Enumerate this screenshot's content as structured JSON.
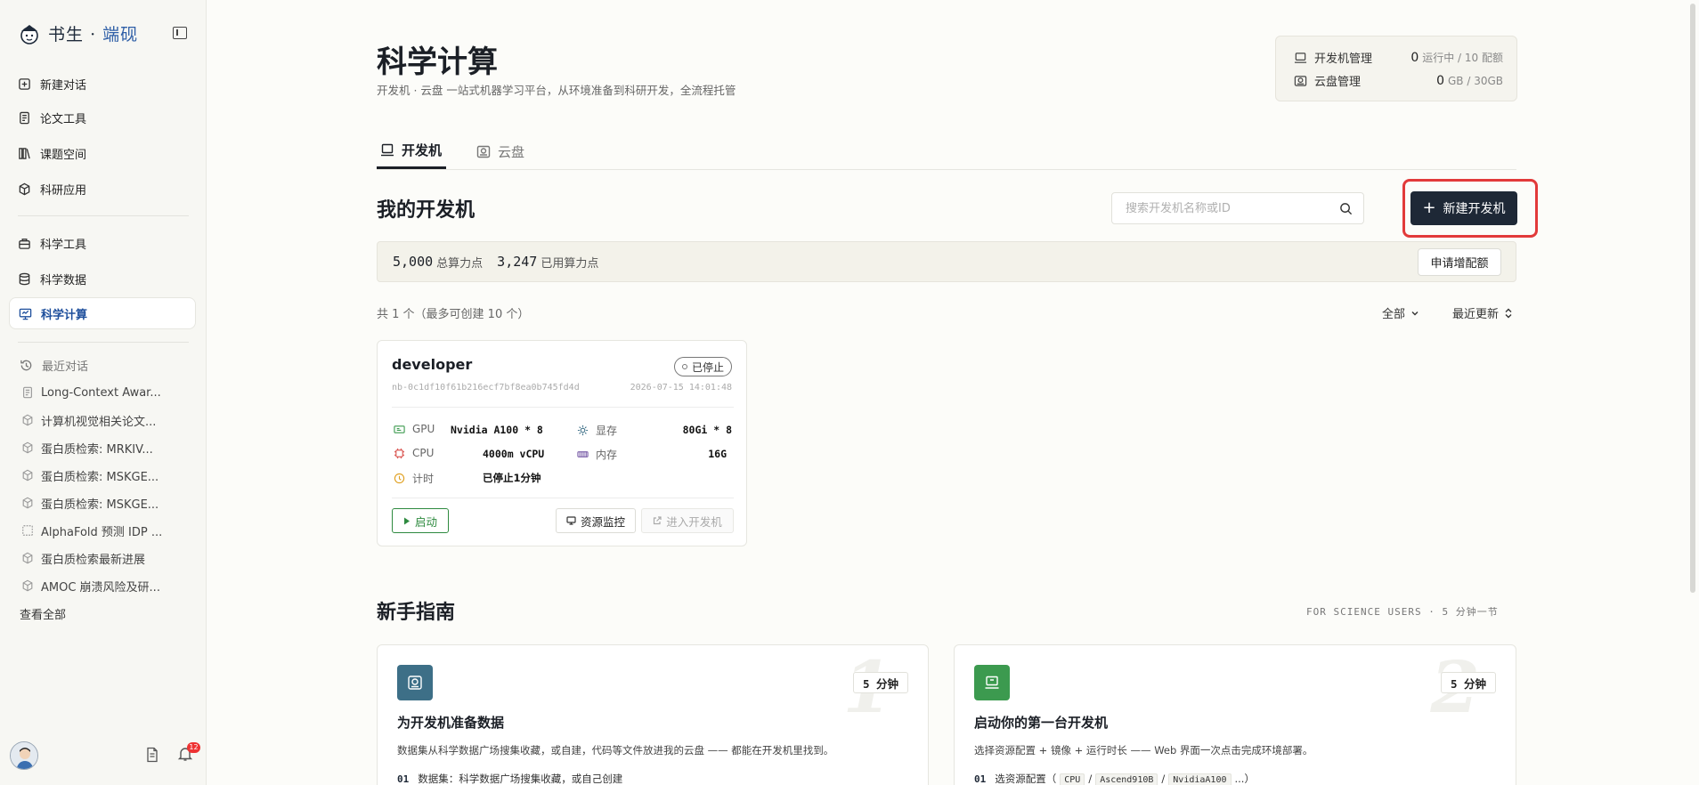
{
  "brand": {
    "name": "书生",
    "sep": "·",
    "accent": "端砚"
  },
  "sidebar": {
    "items": [
      {
        "label": "新建对话",
        "icon": "plus-square-icon"
      },
      {
        "label": "论文工具",
        "icon": "document-icon"
      },
      {
        "label": "课题空间",
        "icon": "library-icon"
      },
      {
        "label": "科研应用",
        "icon": "cube-icon"
      },
      {
        "label": "科学工具",
        "icon": "toolbox-icon"
      },
      {
        "label": "科学数据",
        "icon": "database-icon"
      },
      {
        "label": "科学计算",
        "icon": "monitor-icon",
        "active": true
      }
    ],
    "recent_title": "最近对话",
    "recent": [
      {
        "label": "Long-Context Awar...",
        "icon": "document-icon"
      },
      {
        "label": "计算机视觉相关论文...",
        "icon": "cube-icon"
      },
      {
        "label": "蛋白质检索: MRKIV...",
        "icon": "cube-icon"
      },
      {
        "label": "蛋白质检索: MSKGE...",
        "icon": "cube-icon"
      },
      {
        "label": "蛋白质检索: MSKGE...",
        "icon": "cube-icon"
      },
      {
        "label": "AlphaFold 预测 IDP ...",
        "icon": "grid-icon"
      },
      {
        "label": "蛋白质检索最新进展",
        "icon": "cube-icon"
      },
      {
        "label": "AMOC 崩溃风险及研...",
        "icon": "cube-icon"
      }
    ],
    "view_all": "查看全部",
    "notification_count": "12"
  },
  "header": {
    "title": "科学计算",
    "subtitle": "开发机 · 云盘 一站式机器学习平台，从环境准备到科研开发，全流程托管"
  },
  "quota": {
    "dev": {
      "label": "开发机管理",
      "value": "0",
      "unit": "运行中 / 10 配额"
    },
    "disk": {
      "label": "云盘管理",
      "value": "0",
      "unit": "GB / 30GB"
    }
  },
  "tabs": [
    {
      "label": "开发机",
      "active": true
    },
    {
      "label": "云盘",
      "active": false
    }
  ],
  "my_dev": {
    "title": "我的开发机",
    "search_placeholder": "搜索开发机名称或ID",
    "new_button": "新建开发机",
    "total_compute": "5,000",
    "total_compute_label": "总算力点",
    "used_compute": "3,247",
    "used_compute_label": "已用算力点",
    "apply_button": "申请增配额",
    "count_text": "共 1 个（最多可创建 10 个）",
    "filter_all": "全部",
    "sort": "最近更新"
  },
  "dev_card": {
    "name": "developer",
    "status": "已停止",
    "id": "nb-0c1df10f61b216ecf7bf8ea0b745fd4d",
    "time": "2026-07-15 14:01:48",
    "gpu_label": "GPU",
    "gpu_value": "Nvidia A100 * 8",
    "vram_label": "显存",
    "vram_value": "80Gi * 8",
    "cpu_label": "CPU",
    "cpu_value": "4000m vCPU",
    "mem_label": "内存",
    "mem_value": "16G",
    "timer_label": "计时",
    "timer_value": "已停止1分钟",
    "start_button": "启动",
    "monitor_button": "资源监控",
    "enter_button": "进入开发机"
  },
  "guide": {
    "title": "新手指南",
    "meta": "FOR SCIENCE USERS · 5 分钟一节",
    "cards": [
      {
        "num": "1",
        "duration": "5 分钟",
        "title": "为开发机准备数据",
        "desc": "数据集从科学数据广场搜集收藏，或自建，代码等文件放进我的云盘 —— 都能在开发机里找到。",
        "step_no": "01",
        "step": "数据集：科学数据广场搜集收藏，或自己创建",
        "icon_color": "#3d6f87"
      },
      {
        "num": "2",
        "duration": "5 分钟",
        "title": "启动你的第一台开发机",
        "desc": "选择资源配置 + 镜像 + 运行时长 —— Web 界面一次点击完成环境部署。",
        "step_no": "01",
        "step_prefix": "选资源配置（",
        "step_codes": [
          "CPU",
          "Ascend910B",
          "NvidiaA100",
          "..."
        ],
        "step_suffix": "）",
        "icon_color": "#3c9a4f"
      }
    ]
  }
}
